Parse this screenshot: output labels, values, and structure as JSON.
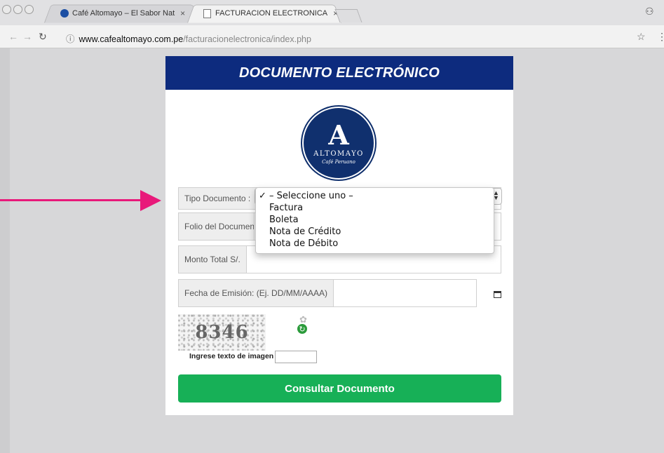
{
  "browser": {
    "tabs": [
      {
        "title": "Café Altomayo – El Sabor Nat",
        "close": "×"
      },
      {
        "title": "FACTURACION ELECTRONICA",
        "close": "×"
      }
    ],
    "url_host": "www.cafealtomayo.com.pe",
    "url_path": "/facturacionelectronica/index.php"
  },
  "header": {
    "title": "DOCUMENTO ELECTRÓNICO"
  },
  "logo": {
    "letter": "A",
    "name": "ALTOMAYO",
    "tagline": "Café Peruano"
  },
  "form": {
    "tipo_label": "Tipo Documento :",
    "folio_label": "Folio del Documento",
    "monto_label": "Monto Total S/.",
    "fecha_label": "Fecha de Emisión: (Ej. DD/MM/AAAA)",
    "captcha_text": "8346",
    "captcha_label": "Ingrese texto de imagen",
    "submit_label": "Consultar Documento"
  },
  "dropdown": {
    "selected_mark": "✓",
    "options": [
      "– Seleccione uno –",
      "Factura",
      "Boleta",
      "Nota de Crédito",
      "Nota de Débito"
    ]
  },
  "colors": {
    "header": "#0d2b7e",
    "submit": "#17b057",
    "arrow": "#e8197a"
  },
  "icons": [
    "calendar-icon",
    "refresh-icon",
    "puzzle-icon",
    "star-icon",
    "profile-icon"
  ]
}
